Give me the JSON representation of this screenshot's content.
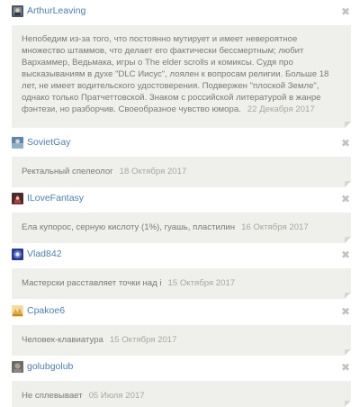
{
  "comments": [
    {
      "username": "ArthurLeaving",
      "avatar_icon": "avatar-arthurleaving-icon",
      "text": "Непобедим из-за того, что постоянно мутирует и имеет невероятное множество штаммов, что делает его фактически бессмертным; любит Вархаммер, Ведьмака, игры о The elder scrolls и комиксы. Судя про высказываниям в духе \"DLC Иисус\", лоялен к вопросам религии. Больше 18 лет, не имеет водительского удостоверения. Подвержен \"плоской Земле\", однако только Пратчеттовской. Знаком с российской литературой в жанре фэнтези, но разборчив. Своеобразное чувство юмора.",
      "date": "22 Декабря 2017",
      "close_icon": "close-icon"
    },
    {
      "username": "SovietGay",
      "avatar_icon": "avatar-sovietgay-icon",
      "text": "Ректальный спелеолог",
      "date": "18 Октября 2017",
      "close_icon": "close-icon"
    },
    {
      "username": "ILoveFantasy",
      "avatar_icon": "avatar-ilovefantasy-icon",
      "text": "Ела купорос, серную кислоту (1%), гуашь, пластилин",
      "date": "16 Октября 2017",
      "close_icon": "close-icon"
    },
    {
      "username": "Vlad842",
      "avatar_icon": "avatar-vlad842-icon",
      "text": "Мастерски расставляет точки над і",
      "date": "15 Октября 2017",
      "close_icon": "close-icon"
    },
    {
      "username": "Cpakoe6",
      "avatar_icon": "avatar-cpakoe6-icon",
      "text": "Человек-клавиатура",
      "date": "15 Октября 2017",
      "close_icon": "close-icon"
    },
    {
      "username": "golubgolub",
      "avatar_icon": "avatar-golubgolub-icon",
      "text": "Не сплевывает",
      "date": "05 Июля 2017",
      "close_icon": "close-icon"
    }
  ],
  "close_glyph": "✖",
  "colors": {
    "username": "#4a7fb0",
    "bubble_bg": "#efefeb",
    "text": "#7a7a75",
    "date": "#a8a8a2",
    "close": "#c2c2c2"
  }
}
